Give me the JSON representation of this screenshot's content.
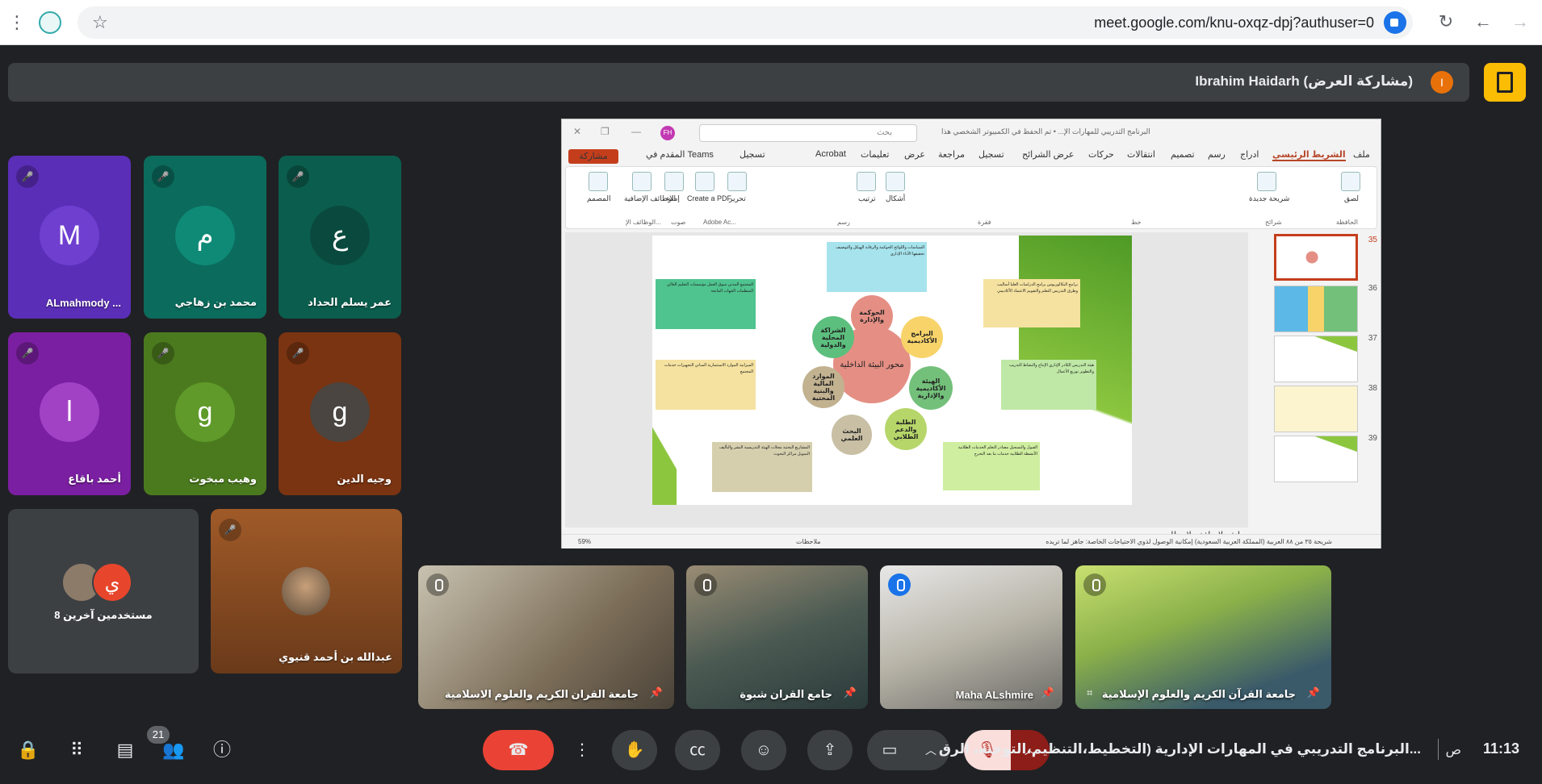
{
  "browser": {
    "url": "meet.google.com/knu-oxqz-dpj?authuser=0"
  },
  "presenter": {
    "label": "Ibrahim Haidarh (مشاركة العرض)",
    "avatar_letter": "I",
    "avatar_color": "#e8710a"
  },
  "participants": [
    {
      "name": "ALmahmody ...",
      "letter": "M",
      "bg": "#5b2eb8",
      "avatar_bg": "#6f3fd0"
    },
    {
      "name": "محمد بن زهاجي",
      "letter": "م",
      "bg": "#0b6b5c",
      "avatar_bg": "#0e8a76"
    },
    {
      "name": "عمر يسلم الحداد",
      "letter": "ع",
      "bg": "#0b5e4e",
      "avatar_bg": "#0a4a3e"
    },
    {
      "name": "أحمد باقاع",
      "letter": "ا",
      "bg": "#7b1fa2",
      "avatar_bg": "#a142c4"
    },
    {
      "name": "وهيب مبخوت",
      "letter": "g",
      "bg": "#4b7a1e",
      "avatar_bg": "#5f9a2a"
    },
    {
      "name": "وجيه الدين",
      "letter": "g",
      "bg": "#7a3412",
      "avatar_bg": "#4a4540"
    }
  ],
  "others_tile": {
    "label": "8 مستخدمين آخرين",
    "avatar_letter": "ي"
  },
  "abdullah_tile": {
    "name": "عبدالله بن أحمد قنيوي"
  },
  "slide_app": {
    "search_placeholder": "بحث",
    "doc_title": "البرنامج التدريبي للمهارات الإ... • تم الحفظ في الكمبيوتر الشخصي هذا",
    "user_initials": "FH",
    "tabs": [
      "ملف",
      "الشريط الرئيسي",
      "ادراج",
      "رسم",
      "تصميم",
      "انتقالات",
      "حركات",
      "عرض الشرائح",
      "تسجيل",
      "مراجعة",
      "عرض",
      "تعليمات",
      "Acrobat"
    ],
    "record_label": "تسجيل",
    "teams_label": "المقدم في Teams",
    "share_label": "مشاركة",
    "ribbon_groups": [
      "الحافظة",
      "شرائح",
      "خط",
      "فقرة",
      "رسم",
      "Adobe Ac...",
      "صوت",
      "الوظائف الإ..."
    ],
    "ribbon_tools": [
      "المصمم",
      "الوظائف الإضافية",
      "إملاء",
      "Create a PDF",
      "تحرير",
      "ترتيب",
      "أشكال",
      "شريحة جديدة",
      "لصق"
    ],
    "notes_label": "انقر لإضافة ملاحظات",
    "status_left": "59%",
    "status_right": "شريحة ٣٥ من ٨٨   العربية (المملكة العربية السعودية)   إمكانية الوصول لذوي الاحتياجات الخاصة: جاهز لما تريده",
    "notes_button": "ملاحظات"
  },
  "slide": {
    "center": "محور البيئة الداخلية",
    "nodes": [
      "الحوكمة والإدارة",
      "البرامج الأكاديمية",
      "الهيئة الأكاديمية والإدارية",
      "الطلبة والدعم الطلابي",
      "البحث العلمي",
      "الموارد المالية والبنية المحتية",
      "الشراكة المحلية والدولية"
    ],
    "boxes": [
      "السياسات واللوائح الحوكمة والرقابة الهيكل والتوصيف تحقيقها الأداء الإداري",
      "برامج البكالوريوس برامج الدراسات العليا أساليب وطرق التدريس التعلم والتقويم الاعتماد الأكاديمي",
      "هيئة التدريس الكادر الإداري الإنتاج والنشاط التدريب والتطوير توزيع الأعمال",
      "القبول والتسجيل مصادر التعلم الخدمات الطلابية الأنشطة الطلابية خدمات ما بعد التخرج",
      "المشاريع البحثية مجلات الهيئة التدريسية النشر والتأليف التمويل مراكز البحوث",
      "الميزانية الموارد الاستثمارية المباني التجهيزات خدمات المجتمع",
      "المجتمع المدني سوق العمل مؤسسات التعليم العالي المنظمات الجهات المانحة"
    ],
    "thumb_numbers": [
      "35",
      "36",
      "37",
      "38",
      "39"
    ]
  },
  "video_tiles": [
    {
      "name": "جامعة القران الكريم والعلوم الاسلامية"
    },
    {
      "name": "جامع القران شبوة"
    },
    {
      "name": "Maha ALshmire"
    },
    {
      "name": "جامعة القرآن الكريم والعلوم الإسلامية"
    }
  ],
  "bottom": {
    "time": "11:13",
    "ampm": "ص",
    "meeting_title": "البرنامج التدريبي في المهارات الإدارية (التخطيط،التنظيم،التوجيه، الرق...",
    "participants_count": "21"
  },
  "colors": {
    "end_call": "#ea4335",
    "mic_off_bg": "#f9dedc",
    "exit_button": "#fbbc04"
  }
}
